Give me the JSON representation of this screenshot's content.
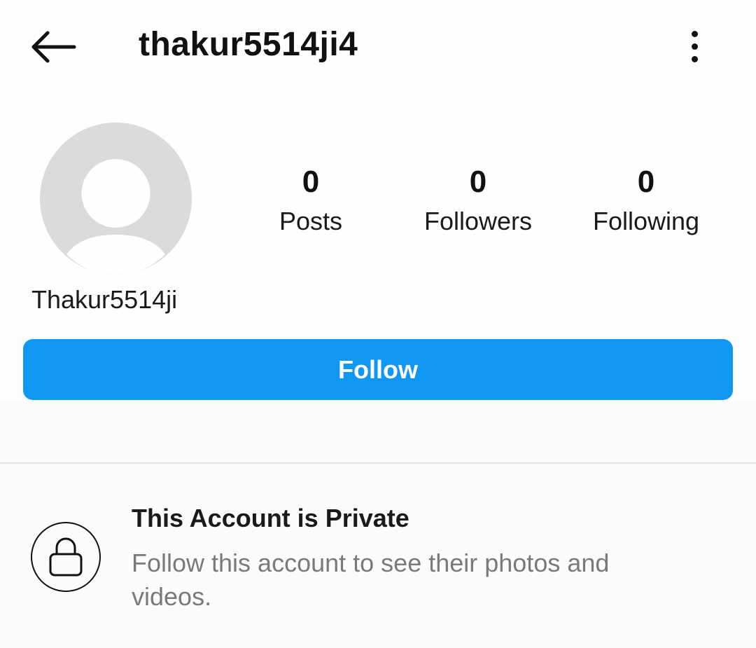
{
  "header": {
    "username": "thakur5514ji4",
    "back_icon": "arrow-left-icon",
    "more_icon": "vertical-dots-icon"
  },
  "profile": {
    "avatar_icon": "default-avatar-icon",
    "display_name": "Thakur5514ji",
    "stats": [
      {
        "value": "0",
        "label": "Posts"
      },
      {
        "value": "0",
        "label": "Followers"
      },
      {
        "value": "0",
        "label": "Following"
      }
    ]
  },
  "actions": {
    "follow_label": "Follow",
    "follow_color": "#1097f2"
  },
  "private_notice": {
    "icon": "lock-icon",
    "title": "This Account is Private",
    "description": "Follow this account to see their photos and videos."
  }
}
